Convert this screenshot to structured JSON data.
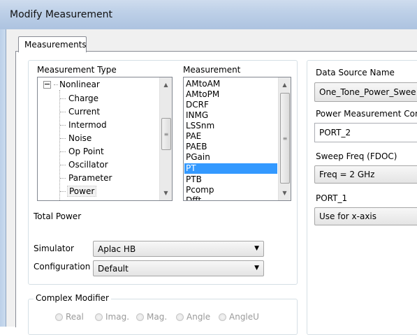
{
  "window": {
    "title": "Modify Measurement"
  },
  "tabs": [
    {
      "label": "Measurements"
    }
  ],
  "measurement_type": {
    "header": "Measurement Type",
    "parent": "Nonlinear",
    "children": [
      "Charge",
      "Current",
      "Intermod",
      "Noise",
      "Op Point",
      "Oscillator",
      "Parameter",
      "Power"
    ],
    "selected": "Power"
  },
  "measurement": {
    "header": "Measurement",
    "items": [
      "AMtoAM",
      "AMtoPM",
      "DCRF",
      "INMG",
      "LSSnm",
      "PAE",
      "PAEB",
      "PGain",
      "PT",
      "PTB",
      "Pcomp"
    ],
    "selected": "PT"
  },
  "description": "Total Power",
  "simulator": {
    "label": "Simulator",
    "value": "Aplac HB"
  },
  "configuration": {
    "label": "Configuration",
    "value": "Default"
  },
  "complex_modifier": {
    "label": "Complex Modifier",
    "options": [
      "Real",
      "Imag.",
      "Mag.",
      "Angle",
      "AngleU"
    ]
  },
  "right_panel": {
    "data_source": {
      "label": "Data Source Name",
      "value": "One_Tone_Power_Swee"
    },
    "power_comp": {
      "label": "Power Measurement Comp",
      "value": "PORT_2"
    },
    "sweep_freq": {
      "label": "Sweep Freq (FDOC)",
      "value": "Freq = 2 GHz"
    },
    "port1": {
      "label": "PORT_1",
      "value": "Use for x-axis"
    }
  },
  "colors": {
    "selection": "#3399ff",
    "titlebar": "#bccfe7"
  }
}
